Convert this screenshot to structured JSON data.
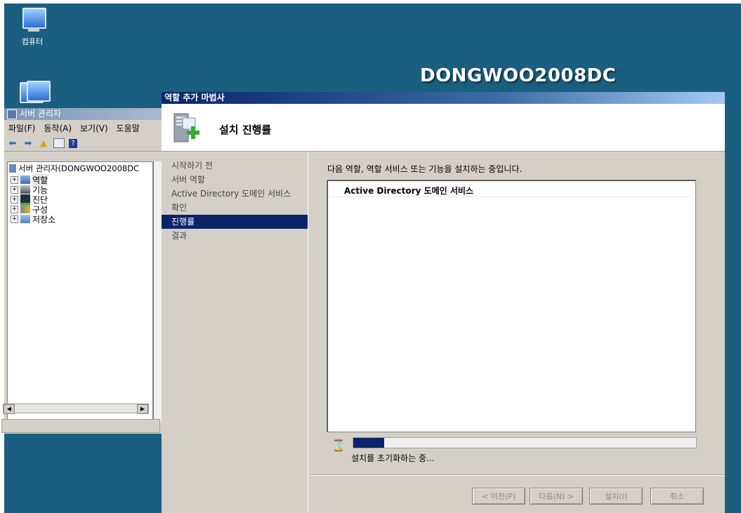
{
  "desktop": {
    "hostname": "DONGWOO2008DC",
    "icons": [
      {
        "label": "컴퓨터",
        "icon": "computer-icon"
      },
      {
        "label": "",
        "icon": "network-icon"
      }
    ]
  },
  "server_manager": {
    "title": "서버 관리자",
    "menu": [
      "파일(F)",
      "동작(A)",
      "보기(V)",
      "도움말"
    ],
    "tree_root": "서버 관리자(DONGWOO2008DC",
    "tree_items": [
      {
        "label": "역할",
        "icon": "roles-icon"
      },
      {
        "label": "기능",
        "icon": "features-icon"
      },
      {
        "label": "진단",
        "icon": "diagnostics-icon"
      },
      {
        "label": "구성",
        "icon": "configuration-icon"
      },
      {
        "label": "저장소",
        "icon": "storage-icon"
      }
    ]
  },
  "wizard": {
    "title": "역할 추가 마법사",
    "header_title": "설치 진행률",
    "nav": [
      "시작하기 전",
      "서버 역할",
      "Active Directory 도메인 서비스",
      "확인",
      "진행률",
      "결과"
    ],
    "active_nav_index": 4,
    "description": "다음 역할, 역할 서비스 또는 기능을 설치하는 중입니다.",
    "list_items": [
      "Active Directory 도메인 서비스"
    ],
    "progress_percent": 9,
    "status": "설치를 초기화하는 중...",
    "buttons": {
      "prev": "< 이전(P)",
      "next": "다음(N) >",
      "install": "설치(I)",
      "cancel": "취소"
    }
  }
}
